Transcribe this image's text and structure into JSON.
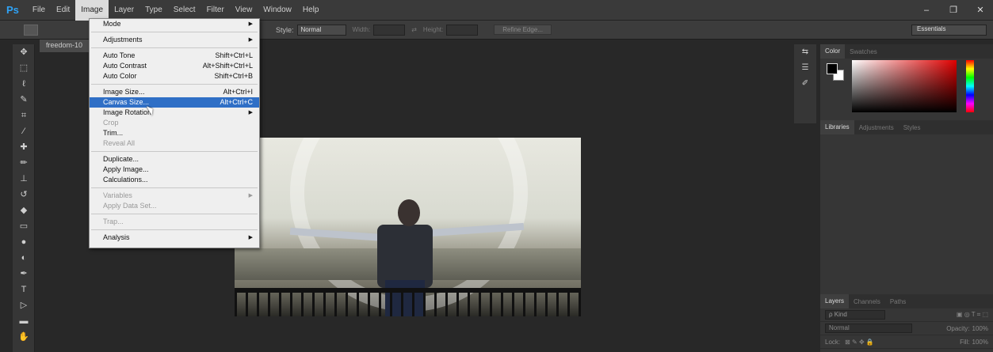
{
  "app": {
    "logo": "Ps",
    "document_tab": "freedom-10",
    "workspace": "Essentials"
  },
  "menubar": {
    "items": [
      "File",
      "Edit",
      "Image",
      "Layer",
      "Type",
      "Select",
      "Filter",
      "View",
      "Window",
      "Help"
    ]
  },
  "window_controls": [
    "–",
    "❐",
    "✕"
  ],
  "options": {
    "style_label": "Style:",
    "style_value": "Normal",
    "width_label": "Width:",
    "height_label": "Height:",
    "refine_edge": "Refine Edge..."
  },
  "image_menu": {
    "items": [
      {
        "label": "Mode",
        "submenu": true
      },
      {
        "label": "Adjustments",
        "submenu": true
      },
      {
        "label": "Auto Tone",
        "shortcut": "Shift+Ctrl+L"
      },
      {
        "label": "Auto Contrast",
        "shortcut": "Alt+Shift+Ctrl+L"
      },
      {
        "label": "Auto Color",
        "shortcut": "Shift+Ctrl+B"
      },
      {
        "label": "Image Size...",
        "shortcut": "Alt+Ctrl+I"
      },
      {
        "label": "Canvas Size...",
        "shortcut": "Alt+Ctrl+C",
        "highlighted": true
      },
      {
        "label": "Image Rotation",
        "submenu": true
      },
      {
        "label": "Crop",
        "disabled": true
      },
      {
        "label": "Trim..."
      },
      {
        "label": "Reveal All",
        "disabled": true
      },
      {
        "label": "Duplicate..."
      },
      {
        "label": "Apply Image..."
      },
      {
        "label": "Calculations..."
      },
      {
        "label": "Variables",
        "disabled": true,
        "submenu": true
      },
      {
        "label": "Apply Data Set...",
        "disabled": true
      },
      {
        "label": "Trap...",
        "disabled": true
      },
      {
        "label": "Analysis",
        "submenu": true
      }
    ]
  },
  "panels": {
    "color_tabs": [
      "Color",
      "Swatches"
    ],
    "library_tabs": [
      "Libraries",
      "Adjustments",
      "Styles"
    ],
    "layers_tabs": [
      "Layers",
      "Channels",
      "Paths"
    ],
    "kind_placeholder": "ρ Kind",
    "blend_mode": "Normal",
    "opacity_label": "Opacity:",
    "opacity_value": "100%",
    "lock_label": "Lock:",
    "fill_label": "Fill:",
    "fill_value": "100%"
  },
  "tools": [
    "move-tool-icon",
    "marquee-tool-icon",
    "lasso-tool-icon",
    "quick-select-tool-icon",
    "crop-tool-icon",
    "eyedropper-tool-icon",
    "healing-brush-icon",
    "brush-tool-icon",
    "clone-stamp-icon",
    "history-brush-icon",
    "eraser-tool-icon",
    "gradient-tool-icon",
    "blur-tool-icon",
    "dodge-tool-icon",
    "pen-tool-icon",
    "type-tool-icon",
    "path-select-icon",
    "rectangle-tool-icon",
    "hand-tool-icon",
    "zoom-tool-icon"
  ]
}
